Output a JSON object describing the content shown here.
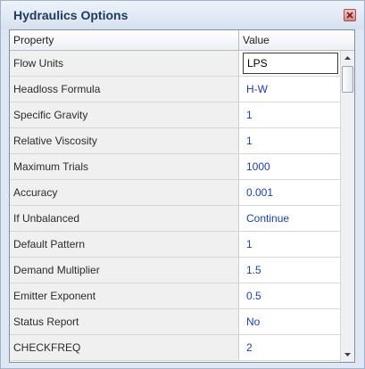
{
  "window": {
    "title": "Hydraulics Options",
    "close_icon": "close-icon"
  },
  "grid": {
    "columns": [
      "Property",
      "Value"
    ],
    "rows": [
      {
        "property": "Flow Units",
        "value": "LPS"
      },
      {
        "property": "Headloss Formula",
        "value": "H-W"
      },
      {
        "property": "Specific Gravity",
        "value": "1"
      },
      {
        "property": "Relative Viscosity",
        "value": "1"
      },
      {
        "property": "Maximum Trials",
        "value": "1000"
      },
      {
        "property": "Accuracy",
        "value": "0.001"
      },
      {
        "property": "If Unbalanced",
        "value": "Continue"
      },
      {
        "property": "Default Pattern",
        "value": "1"
      },
      {
        "property": "Demand Multiplier",
        "value": "1.5"
      },
      {
        "property": "Emitter Exponent",
        "value": "0.5"
      },
      {
        "property": "Status Report",
        "value": "No"
      },
      {
        "property": "CHECKFREQ",
        "value": "2"
      }
    ],
    "active_row": "Flow Units"
  },
  "colors": {
    "value_text": "#1a3fb3",
    "property_bg": "#f0f0f0",
    "title_text": "#1e3a60"
  },
  "scrollbar": {
    "up_icon": "scroll-up-arrow-icon",
    "down_icon": "scroll-down-arrow-icon",
    "position": 0
  }
}
